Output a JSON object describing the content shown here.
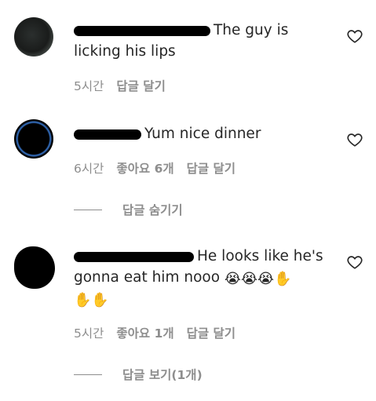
{
  "comments": [
    {
      "text_end": "The guy is",
      "text_line2": "licking his lips",
      "time": "5시간",
      "reply_label": "답글 달기"
    },
    {
      "text_end": "Yum nice dinner",
      "time": "6시간",
      "likes": "좋아요 6개",
      "reply_label": "답글 달기",
      "thread_label": "답글 숨기기"
    },
    {
      "text_end": "He looks like he's",
      "text_line2": "gonna eat him nooo",
      "emojis_line2": "😭😭😭✋",
      "emojis_line3": "✋✋",
      "time": "5시간",
      "likes": "좋아요 1개",
      "reply_label": "답글 달기",
      "thread_label": "답글 보기(1개)"
    }
  ],
  "icons": {
    "like": "heart-outline-icon"
  },
  "colors": {
    "text": "#262626",
    "meta": "#8e8e8e",
    "redaction": "#000000"
  }
}
